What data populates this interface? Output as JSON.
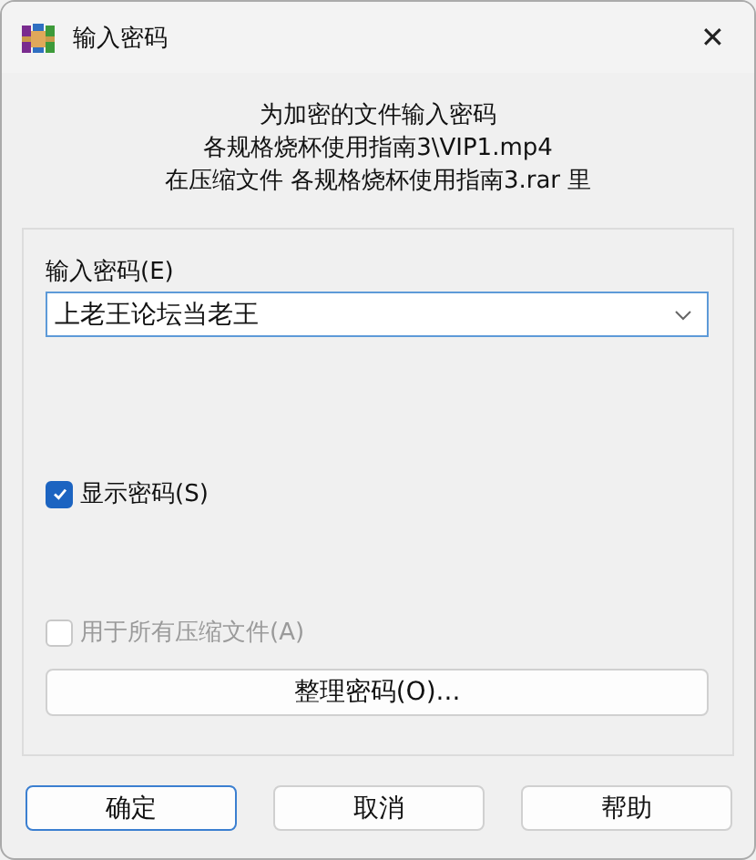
{
  "window": {
    "title": "输入密码",
    "close": "✕"
  },
  "message": [
    "为加密的文件输入密码",
    "各规格烧杯使用指南3\\VIP1.mp4",
    "在压缩文件 各规格烧杯使用指南3.rar 里"
  ],
  "password": {
    "label": "输入密码(E)",
    "value": "上老王论坛当老王"
  },
  "show_password": {
    "label": "显示密码(S)",
    "checked": true,
    "disabled": false
  },
  "use_for_all": {
    "label": "用于所有压缩文件(A)",
    "checked": false,
    "disabled": true
  },
  "organize_button": "整理密码(O)...",
  "buttons": [
    {
      "label": "确定",
      "default": true
    },
    {
      "label": "取消",
      "default": false
    },
    {
      "label": "帮助",
      "default": false
    }
  ]
}
